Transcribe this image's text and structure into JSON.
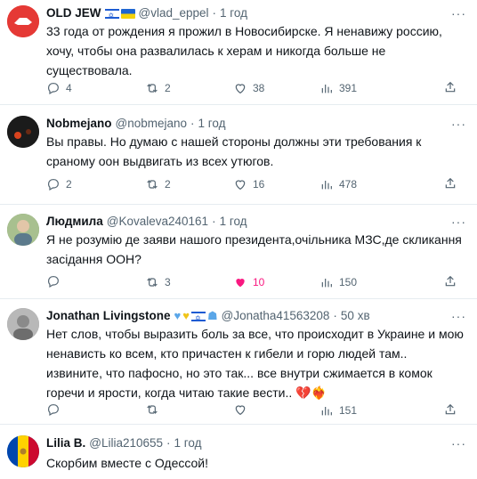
{
  "tweets": [
    {
      "name": "OLD JEW",
      "handle": "@vlad_eppel",
      "dot": "·",
      "time": "1 год",
      "text": "33 года от рождения я прожил в Новосибирске. Я ненавижу россию, хочу, чтобы она развалилась к херам и никогда больше не существовала.",
      "replies": "4",
      "retweets": "2",
      "likes": "38",
      "views": "391",
      "liked": false,
      "avatar_color": "#e53935"
    },
    {
      "name": "Nobmejano",
      "handle": "@nobmejano",
      "dot": "·",
      "time": "1 год",
      "text": "Вы правы. Но думаю с нашей стороны должны эти требования к сраному оон выдвигать из всех утюгов.",
      "replies": "2",
      "retweets": "2",
      "likes": "16",
      "views": "478",
      "liked": false,
      "avatar_color": "#1b1b1b"
    },
    {
      "name": "Людмила",
      "handle": "@Kovaleva240161",
      "dot": "·",
      "time": "1 год",
      "text": "Я не розумію де заяви нашого президента,очільника МЗС,де скликання засідання ООН?",
      "replies": "",
      "retweets": "3",
      "likes": "10",
      "views": "150",
      "liked": true,
      "avatar_color": "#7d9c6b"
    },
    {
      "name": "Jonathan Livingstone",
      "handle": "@Jonatha41563208",
      "dot": "·",
      "time": "50 хв",
      "text": "Нет слов, чтобы выразить боль за все, что происходит в Украине и мою ненависть ко всем, кто причастен к гибели и горю людей там.. извините, что пафосно,  но это так... все внутри сжимается в комок горечи и ярости, когда читаю такие вести.. 💔❤️‍🔥",
      "replies": "",
      "retweets": "",
      "likes": "",
      "views": "151",
      "liked": false,
      "avatar_color": "#9a9a9a"
    },
    {
      "name": "Lilia B.",
      "handle": "@Lilia210655",
      "dot": "·",
      "time": "1 год",
      "text": "Скорбим вместе с Одессой!",
      "avatar_color": "#0046ae"
    }
  ],
  "more_label": "···"
}
